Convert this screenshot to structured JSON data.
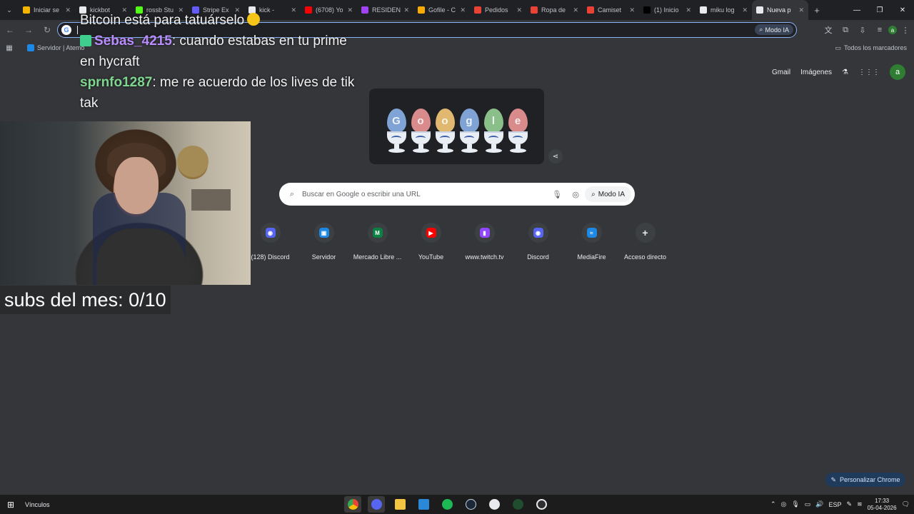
{
  "tabs": [
    {
      "label": "Iniciar se",
      "color": "#f4b400"
    },
    {
      "label": "kickbot",
      "color": "#e8eaed"
    },
    {
      "label": "rossb Stu",
      "color": "#53fc18"
    },
    {
      "label": "Stripe Ex",
      "color": "#635bff"
    },
    {
      "label": "kick -",
      "color": "#e8eaed",
      "active_like": true
    },
    {
      "label": "(6708) Yo",
      "color": "#ff0000"
    },
    {
      "label": "RESIDEN",
      "color": "#a142f4"
    },
    {
      "label": "Gofile - C",
      "color": "#f9ab00"
    },
    {
      "label": "Pedidos",
      "color": "#ea4335"
    },
    {
      "label": "Ropa de",
      "color": "#ea4335"
    },
    {
      "label": "Camiset",
      "color": "#ea4335"
    },
    {
      "label": "(1) Inicio",
      "color": "#000000"
    },
    {
      "label": "miku log",
      "color": "#e8eaed"
    },
    {
      "label": "Nueva p",
      "color": "#e8eaed",
      "active": true
    }
  ],
  "omnibox": {
    "ai_label": "Modo IA"
  },
  "bookmarks": {
    "first_label": "Servidor | Atemo",
    "all_label": "Todos los marcadores"
  },
  "ntp": {
    "gmail": "Gmail",
    "images": "Imágenes",
    "avatar_letter": "a"
  },
  "search": {
    "placeholder": "Buscar en Google o escribir una URL",
    "ai_label": "Modo IA"
  },
  "shortcuts": [
    {
      "label": "(128) Discord",
      "icon": "discord-icon",
      "color": "#5865f2",
      "glyph": "◉"
    },
    {
      "label": "Servidor",
      "icon": "server-icon",
      "color": "#1e88e5",
      "glyph": "▣"
    },
    {
      "label": "Mercado Libre ...",
      "icon": "mercadolibre-icon",
      "color": "#0b8043",
      "glyph": "M"
    },
    {
      "label": "YouTube",
      "icon": "youtube-icon",
      "color": "#ff0000",
      "glyph": "▶"
    },
    {
      "label": "www.twitch.tv",
      "icon": "twitch-icon",
      "color": "#9146ff",
      "glyph": "▮"
    },
    {
      "label": "Discord",
      "icon": "discord-icon",
      "color": "#5865f2",
      "glyph": "◉"
    },
    {
      "label": "MediaFire",
      "icon": "mediafire-icon",
      "color": "#1e88e5",
      "glyph": "≈"
    },
    {
      "label": "Acceso directo",
      "icon": "add-icon",
      "color": "transparent",
      "glyph": "+"
    }
  ],
  "chat": {
    "line0": "Bitcoin está para tatuárselo",
    "user1": "Sebas_4215",
    "msg1": ": cuando estabas en tu prime en hycraft",
    "user2": "sprnfo1287",
    "msg2": ": me re acuerdo de los lives de tik tak"
  },
  "overlay": {
    "subs_text": "subs del mes: 0/10"
  },
  "customize_label": "Personalizar Chrome",
  "taskbar": {
    "vinculos": "Vínculos",
    "lang": "ESP",
    "time": "17:33",
    "date": "05-04-2026"
  }
}
